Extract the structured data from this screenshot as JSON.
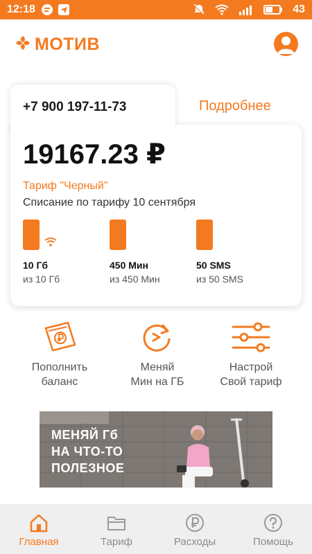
{
  "colors": {
    "accent": "#f47a1f",
    "text": "#1a1a1a",
    "muted": "#8a8a8a",
    "nav_bg": "#efefef"
  },
  "status_bar": {
    "time": "12:18",
    "battery": "43"
  },
  "header": {
    "logo_text": "МОТИВ"
  },
  "card": {
    "phone_number": "+7 900 197-11-73",
    "details_link": "Подробнее",
    "balance": "19167.23 ₽",
    "tariff": "Тариф \"Черный\"",
    "charge_info": "Списание по тарифу 10 сентября",
    "resources": [
      {
        "value": "10 Гб",
        "total": "из 10 Гб",
        "icon": "wifi-icon"
      },
      {
        "value": "450 Мин",
        "total": "из 450 Мин"
      },
      {
        "value": "50 SMS",
        "total": "из 50 SMS"
      }
    ]
  },
  "actions": [
    {
      "line1": "Пополнить",
      "line2": "баланс",
      "icon": "wallet-ruble-icon"
    },
    {
      "line1": "Меняй",
      "line2": "Мин на ГБ",
      "icon": "exchange-icon"
    },
    {
      "line1": "Настрой",
      "line2": "Свой тариф",
      "icon": "sliders-icon"
    }
  ],
  "banner": {
    "line1": "МЕНЯЙ Гб",
    "line2": "НА ЧТО-ТО",
    "line3": "ПОЛЕЗНОЕ"
  },
  "bottom_nav": [
    {
      "label": "Главная",
      "icon": "home-icon",
      "active": true
    },
    {
      "label": "Тариф",
      "icon": "folder-icon",
      "active": false
    },
    {
      "label": "Расходы",
      "icon": "ruble-coin-icon",
      "active": false
    },
    {
      "label": "Помощь",
      "icon": "help-icon",
      "active": false
    }
  ]
}
